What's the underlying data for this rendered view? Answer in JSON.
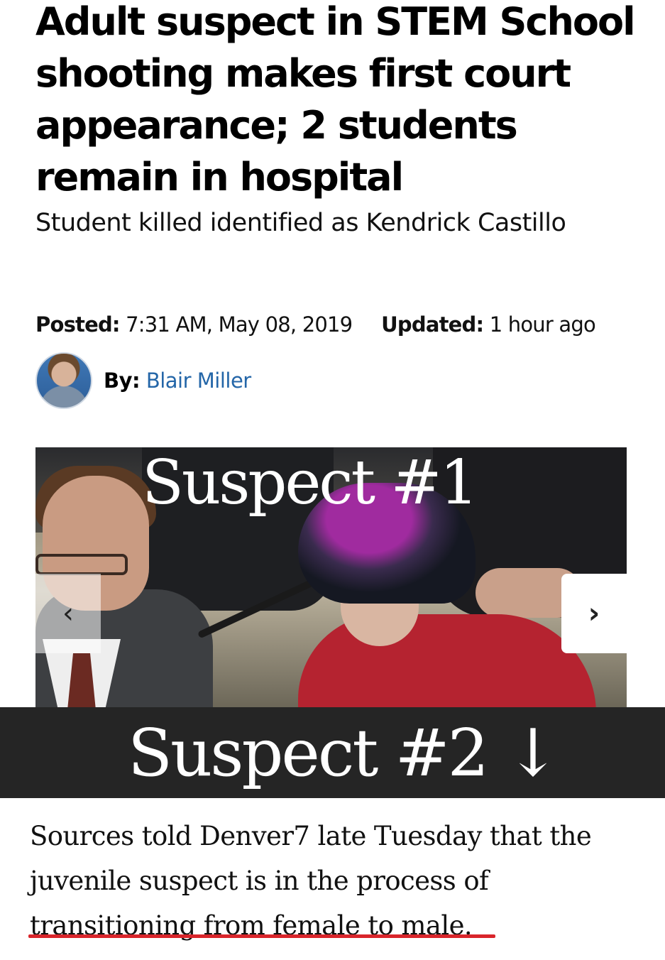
{
  "article": {
    "headline": "Adult suspect in STEM School shooting makes first court appearance; 2 students remain in hospital",
    "subhead": "Student killed identified as Kendrick Castillo",
    "posted_label": "Posted:",
    "posted_value": "7:31 AM, May 08, 2019",
    "updated_label": "Updated:",
    "updated_value": "1 hour ago",
    "by_label": "By:",
    "author": "Blair Miller"
  },
  "gallery": {
    "overlay_text": "Suspect #1",
    "prev_icon": "‹",
    "next_icon": "›"
  },
  "banner": {
    "text": "Suspect #2 ↓"
  },
  "quote": {
    "text": "Sources told Denver7 late Tuesday that the juvenile suspect is in the process of transitioning from female to male."
  },
  "colors": {
    "author_link": "#2466a8",
    "banner_bg": "#252525",
    "underline": "#d9252b"
  }
}
